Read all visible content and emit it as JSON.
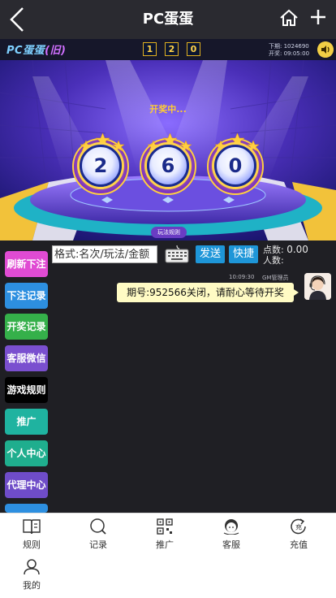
{
  "header": {
    "title": "PC蛋蛋"
  },
  "game": {
    "logo_text": "PC蛋蛋",
    "logo_suffix": "(旧)",
    "top_digits": [
      "1",
      "2",
      "0"
    ],
    "issue_line": "下期: 1024690",
    "open_line": "开奖: 09:05:00",
    "status": "开奖中...",
    "balls": [
      "2",
      "6",
      "0"
    ],
    "rule_button": "玩法规则"
  },
  "bet": {
    "placeholder": "格式:名次/玩法/金额",
    "send_label": "发送",
    "quick_label": "快捷",
    "points_label": "点数:",
    "points_value": "0.00",
    "people_label": "人数:"
  },
  "sidebar": {
    "items": [
      {
        "label": "刷新下注",
        "color": "#e04bd3"
      },
      {
        "label": "下注记录",
        "color": "#2d8fe0"
      },
      {
        "label": "开奖记录",
        "color": "#35b04a"
      },
      {
        "label": "客服微信",
        "color": "#7a4fcf"
      },
      {
        "label": "游戏规则",
        "color": "#000000"
      },
      {
        "label": "推广",
        "color": "#1fb3a0"
      },
      {
        "label": "个人中心",
        "color": "#1fae8e"
      },
      {
        "label": "代理中心",
        "color": "#6f4cc8"
      },
      {
        "label": "",
        "color": "#2d8fe0"
      }
    ]
  },
  "chat": {
    "time": "10:09:30",
    "user": "GM管理员",
    "message": "期号:952566关闭，请耐心等待开奖"
  },
  "nav": {
    "items": [
      {
        "label": "规则",
        "icon": "book-icon"
      },
      {
        "label": "记录",
        "icon": "search-icon"
      },
      {
        "label": "推广",
        "icon": "qrcode-icon"
      },
      {
        "label": "客服",
        "icon": "service-icon"
      },
      {
        "label": "充值",
        "icon": "recharge-icon"
      },
      {
        "label": "我的",
        "icon": "user-icon"
      }
    ]
  },
  "colors": {
    "accent_blue": "#1e96d8",
    "bubble": "#fffbc4",
    "dark_bg": "#1f1f24"
  }
}
